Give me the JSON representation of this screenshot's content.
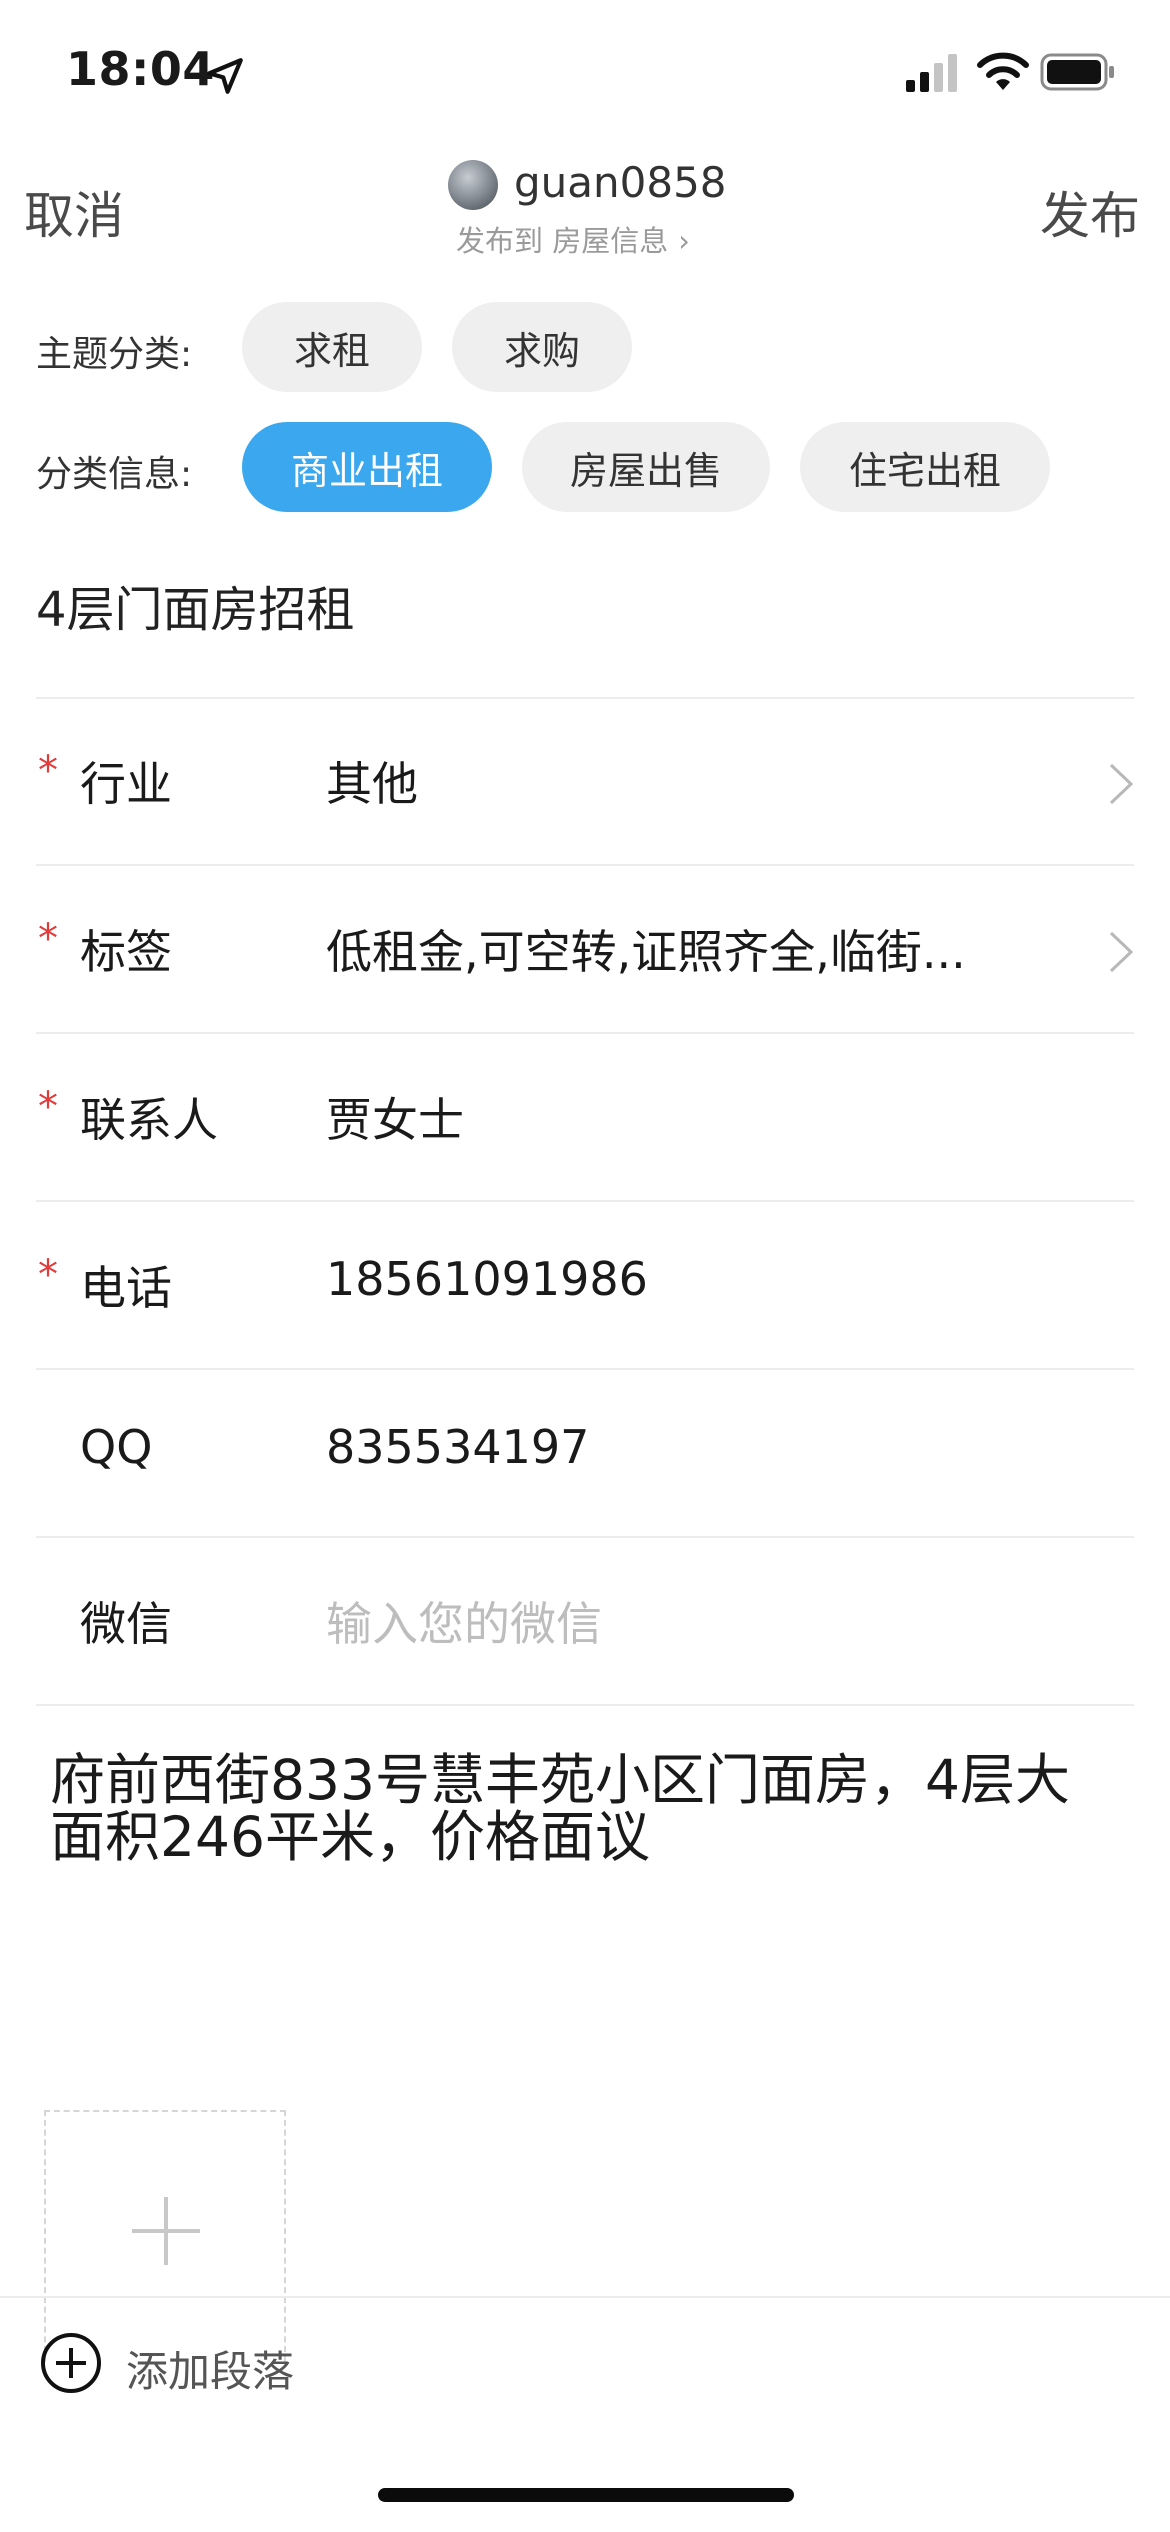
{
  "status_bar": {
    "time": "18:04"
  },
  "nav": {
    "cancel": "取消",
    "publish": "发布",
    "username": "guan0858",
    "publish_to": "发布到 房屋信息",
    "chevron": "›"
  },
  "topic": {
    "label": "主题分类:",
    "chips": [
      {
        "label": "求租"
      },
      {
        "label": "求购"
      }
    ]
  },
  "category": {
    "label": "分类信息:",
    "chips": [
      {
        "label": "商业出租",
        "active": true
      },
      {
        "label": "房屋出售"
      },
      {
        "label": "住宅出租"
      }
    ]
  },
  "post_title": "4层门面房招租",
  "form": {
    "rows": [
      {
        "required": "*",
        "label": "行业",
        "value": "其他"
      },
      {
        "required": "*",
        "label": "标签",
        "value": "低租金,可空转,证照齐全,临街..."
      },
      {
        "required": "*",
        "label": "联系人",
        "value": "贾女士"
      },
      {
        "required": "*",
        "label": "电话",
        "value": "18561091986"
      },
      {
        "required": "",
        "label": "QQ",
        "value": "835534197"
      },
      {
        "required": "",
        "label": "微信",
        "placeholder": "输入您的微信"
      }
    ]
  },
  "description": "府前西街833号慧丰苑小区门面房，4层大面积246平米，价格面议",
  "bottom_bar": {
    "add_paragraph": "添加段落"
  },
  "colors": {
    "accent": "#3aa7ee",
    "required": "#e23b3b",
    "placeholder": "#bdbdbd"
  },
  "icons": [
    "location-arrow-icon",
    "signal-icon",
    "wifi-icon",
    "battery-icon",
    "chevron-right-icon",
    "plus-icon",
    "add-circle-icon"
  ]
}
